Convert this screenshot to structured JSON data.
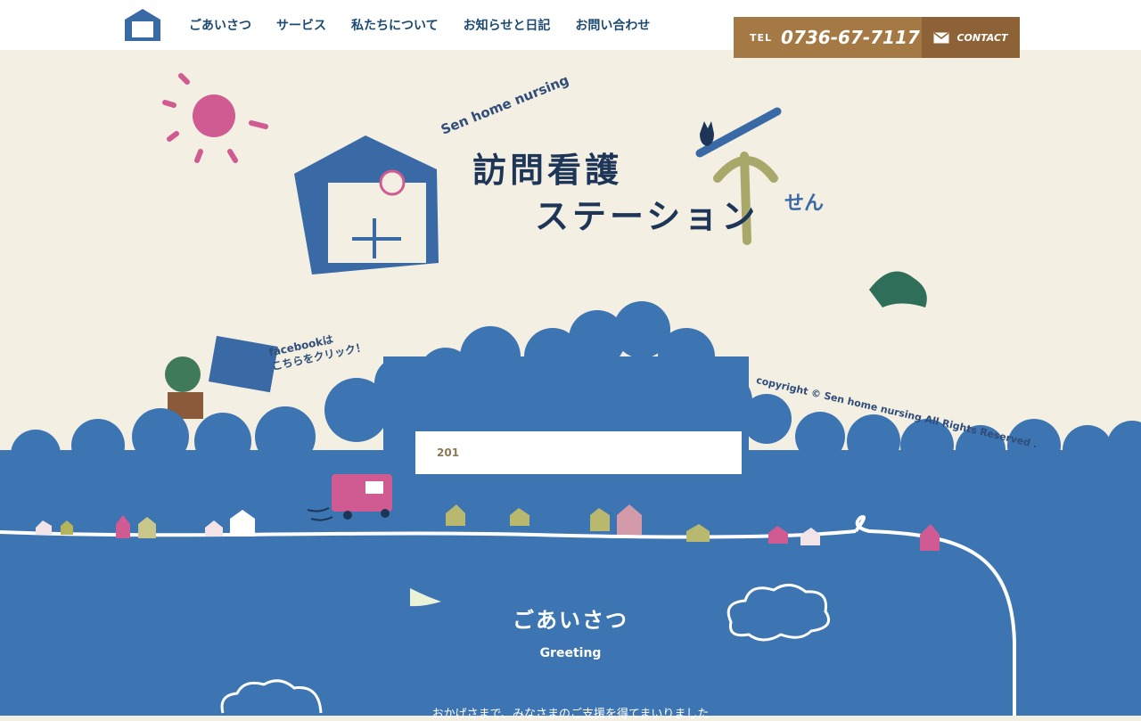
{
  "header": {
    "nav": [
      "ごあいさつ",
      "サービス",
      "私たちについて",
      "お知らせと日記",
      "お問い合わせ"
    ],
    "tel_label": "TEL",
    "tel_number": "0736-67-7117",
    "contact_label": "CONTACT"
  },
  "hero": {
    "brand_en": "Sen home nursing",
    "brand_jp_line1": "訪問看護",
    "brand_jp_line2": "ステーション",
    "brand_mark": "せん",
    "facebook_text": "facebookは\nこちらをクリック！",
    "copyright": "copyright © Sen home nursing  All Rights Reserved ."
  },
  "news": {
    "date_prefix": "201"
  },
  "greeting": {
    "title_jp": "ごあいさつ",
    "title_en": "Greeting",
    "intro": "おかげさまで、みなさまのご支援を得てまいりました"
  },
  "colors": {
    "sky_blue": "#3d74b2",
    "cream": "#f4efe3",
    "pink": "#d05a92",
    "tan": "#a57943",
    "navy": "#1c4a73"
  }
}
